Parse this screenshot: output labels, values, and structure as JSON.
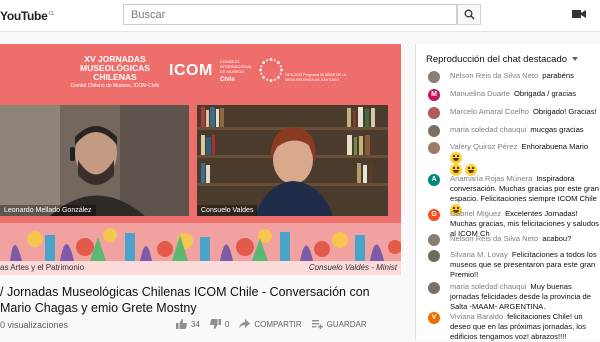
{
  "topbar": {
    "logo": "YouTube",
    "country": "CL",
    "search_placeholder": "Buscar"
  },
  "video": {
    "jornadas_title": "XV JORNADAS MUSEOLÓGICAS CHILENAS",
    "jornadas_sub": "Comité Chileno de Museos, ICOM-Chile",
    "icom": "ICOM",
    "icom_side": "CONSEJO INTERNACIONAL DE MUSEOS",
    "icom_chile": "Chile",
    "anniv_text": "1978-2028 Programa 50 AÑOS DE LA MESA REDONDA DE SANTIAGO",
    "speaker1": "Leonardo Mellado González",
    "speaker2": "Consuelo Valdes",
    "bottom_left": "as Artes y el Patrimonio",
    "bottom_right": "Consuelo Valdés - Minist"
  },
  "info": {
    "title": "/ Jornadas Museológicas Chilenas ICOM Chile - Conversación con Mario Chagas y emio Grete Mostny",
    "views": "0 visualizaciones",
    "likes": "34",
    "dislikes": "0",
    "share": "COMPARTIR",
    "save": "GUARDAR"
  },
  "chat": {
    "header": "Reproducción del chat destacado",
    "messages": [
      {
        "author": "Nelson Reis da Silva Neto",
        "text": "parabéns",
        "avatar_color": "#8a7d72",
        "initial": ""
      },
      {
        "author": "Manuelina Duarte",
        "text": "Obrigada / gracias",
        "avatar_color": "#c2185b",
        "initial": "M"
      },
      {
        "author": "Marcelo Amaral Coelho",
        "text": "Obrigado! Gracias!",
        "avatar_color": "#b35a5a",
        "initial": ""
      },
      {
        "author": "maria soledad chauqui",
        "text": "mucgas gracias",
        "avatar_color": "#7b6f66",
        "initial": ""
      },
      {
        "author": "Valery Quiroz Pérez",
        "text": "Enhorabuena Mario",
        "avatar_color": "#9c7b6a",
        "initial": ""
      },
      {
        "author": "Anamaría Rojas Múnera",
        "text": "Inspiradora conversación. Muchas gracias por este gran espacio. Felicitaciones siempre ICOM Chile",
        "avatar_color": "#00897b",
        "initial": "A"
      },
      {
        "author": "Gabriel Miguez",
        "text": "Excelentes Jornadas! Muchas gracias, mis felicitaciones y saludos al ICOM Ch",
        "avatar_color": "#f4511e",
        "initial": "G"
      },
      {
        "author": "Nelson Reis da Silva Neto",
        "text": "acabou?",
        "avatar_color": "#8a7d72",
        "initial": ""
      },
      {
        "author": "Silvana M. Lovay",
        "text": "Felicitaciones a todos los museos que se presentaron para este gran Premio!!",
        "avatar_color": "#6d6d5a",
        "initial": ""
      },
      {
        "author": "maria soledad chauqui",
        "text": "Muy buenas jornadas felicidades desde la provincia de Salta -MAAM- ARGENTINA.",
        "avatar_color": "#7b6f66",
        "initial": ""
      },
      {
        "author": "Viviana Baraldo",
        "text": "felicitaciones Chile! un deseo que en las próximas jornadas, los edificios tengamos voz! abrazos!!!!",
        "avatar_color": "#ef6c00",
        "initial": "V"
      }
    ]
  }
}
